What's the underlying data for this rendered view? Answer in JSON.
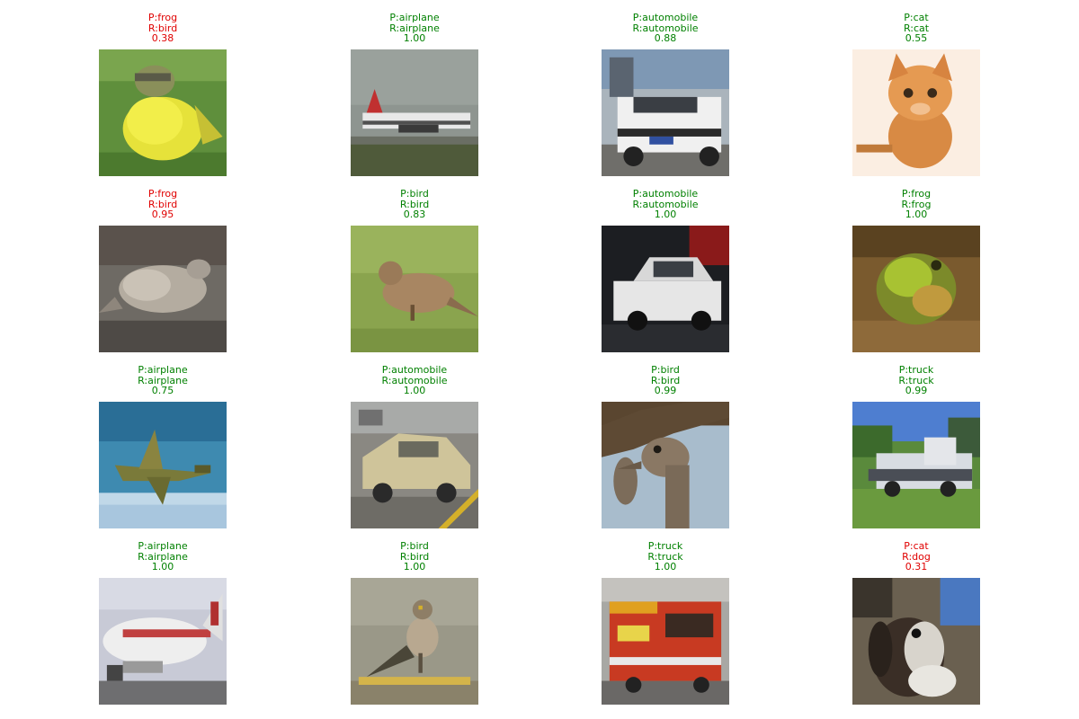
{
  "colors": {
    "correct": "#008000",
    "incorrect": "#e00000"
  },
  "samples": [
    {
      "pred": "P:frog",
      "real": "R:bird",
      "conf": "0.38",
      "correct": false,
      "subject": "yellow bird on grass"
    },
    {
      "pred": "P:airplane",
      "real": "R:airplane",
      "conf": "1.00",
      "correct": true,
      "subject": "airliner on runway"
    },
    {
      "pred": "P:automobile",
      "real": "R:automobile",
      "conf": "0.88",
      "correct": true,
      "subject": "white police car"
    },
    {
      "pred": "P:cat",
      "real": "R:cat",
      "conf": "0.55",
      "correct": true,
      "subject": "orange kitten"
    },
    {
      "pred": "P:frog",
      "real": "R:bird",
      "conf": "0.95",
      "correct": false,
      "subject": "gray bird on ground"
    },
    {
      "pred": "P:bird",
      "real": "R:bird",
      "conf": "0.83",
      "correct": true,
      "subject": "sparrow on grass"
    },
    {
      "pred": "P:automobile",
      "real": "R:automobile",
      "conf": "1.00",
      "correct": true,
      "subject": "white hatchback"
    },
    {
      "pred": "P:frog",
      "real": "R:frog",
      "conf": "1.00",
      "correct": true,
      "subject": "green frog"
    },
    {
      "pred": "P:airplane",
      "real": "R:airplane",
      "conf": "0.75",
      "correct": true,
      "subject": "fighter jet in sky"
    },
    {
      "pred": "P:automobile",
      "real": "R:automobile",
      "conf": "1.00",
      "correct": true,
      "subject": "beige sedan"
    },
    {
      "pred": "P:bird",
      "real": "R:bird",
      "conf": "0.99",
      "correct": true,
      "subject": "ostrich head"
    },
    {
      "pred": "P:truck",
      "real": "R:truck",
      "conf": "0.99",
      "correct": true,
      "subject": "white truck on grass"
    },
    {
      "pred": "P:airplane",
      "real": "R:airplane",
      "conf": "1.00",
      "correct": true,
      "subject": "airliner close-up"
    },
    {
      "pred": "P:bird",
      "real": "R:bird",
      "conf": "1.00",
      "correct": true,
      "subject": "small bird perched"
    },
    {
      "pred": "P:truck",
      "real": "R:truck",
      "conf": "1.00",
      "correct": true,
      "subject": "red fire truck"
    },
    {
      "pred": "P:cat",
      "real": "R:dog",
      "conf": "0.31",
      "correct": false,
      "subject": "puppy"
    }
  ]
}
